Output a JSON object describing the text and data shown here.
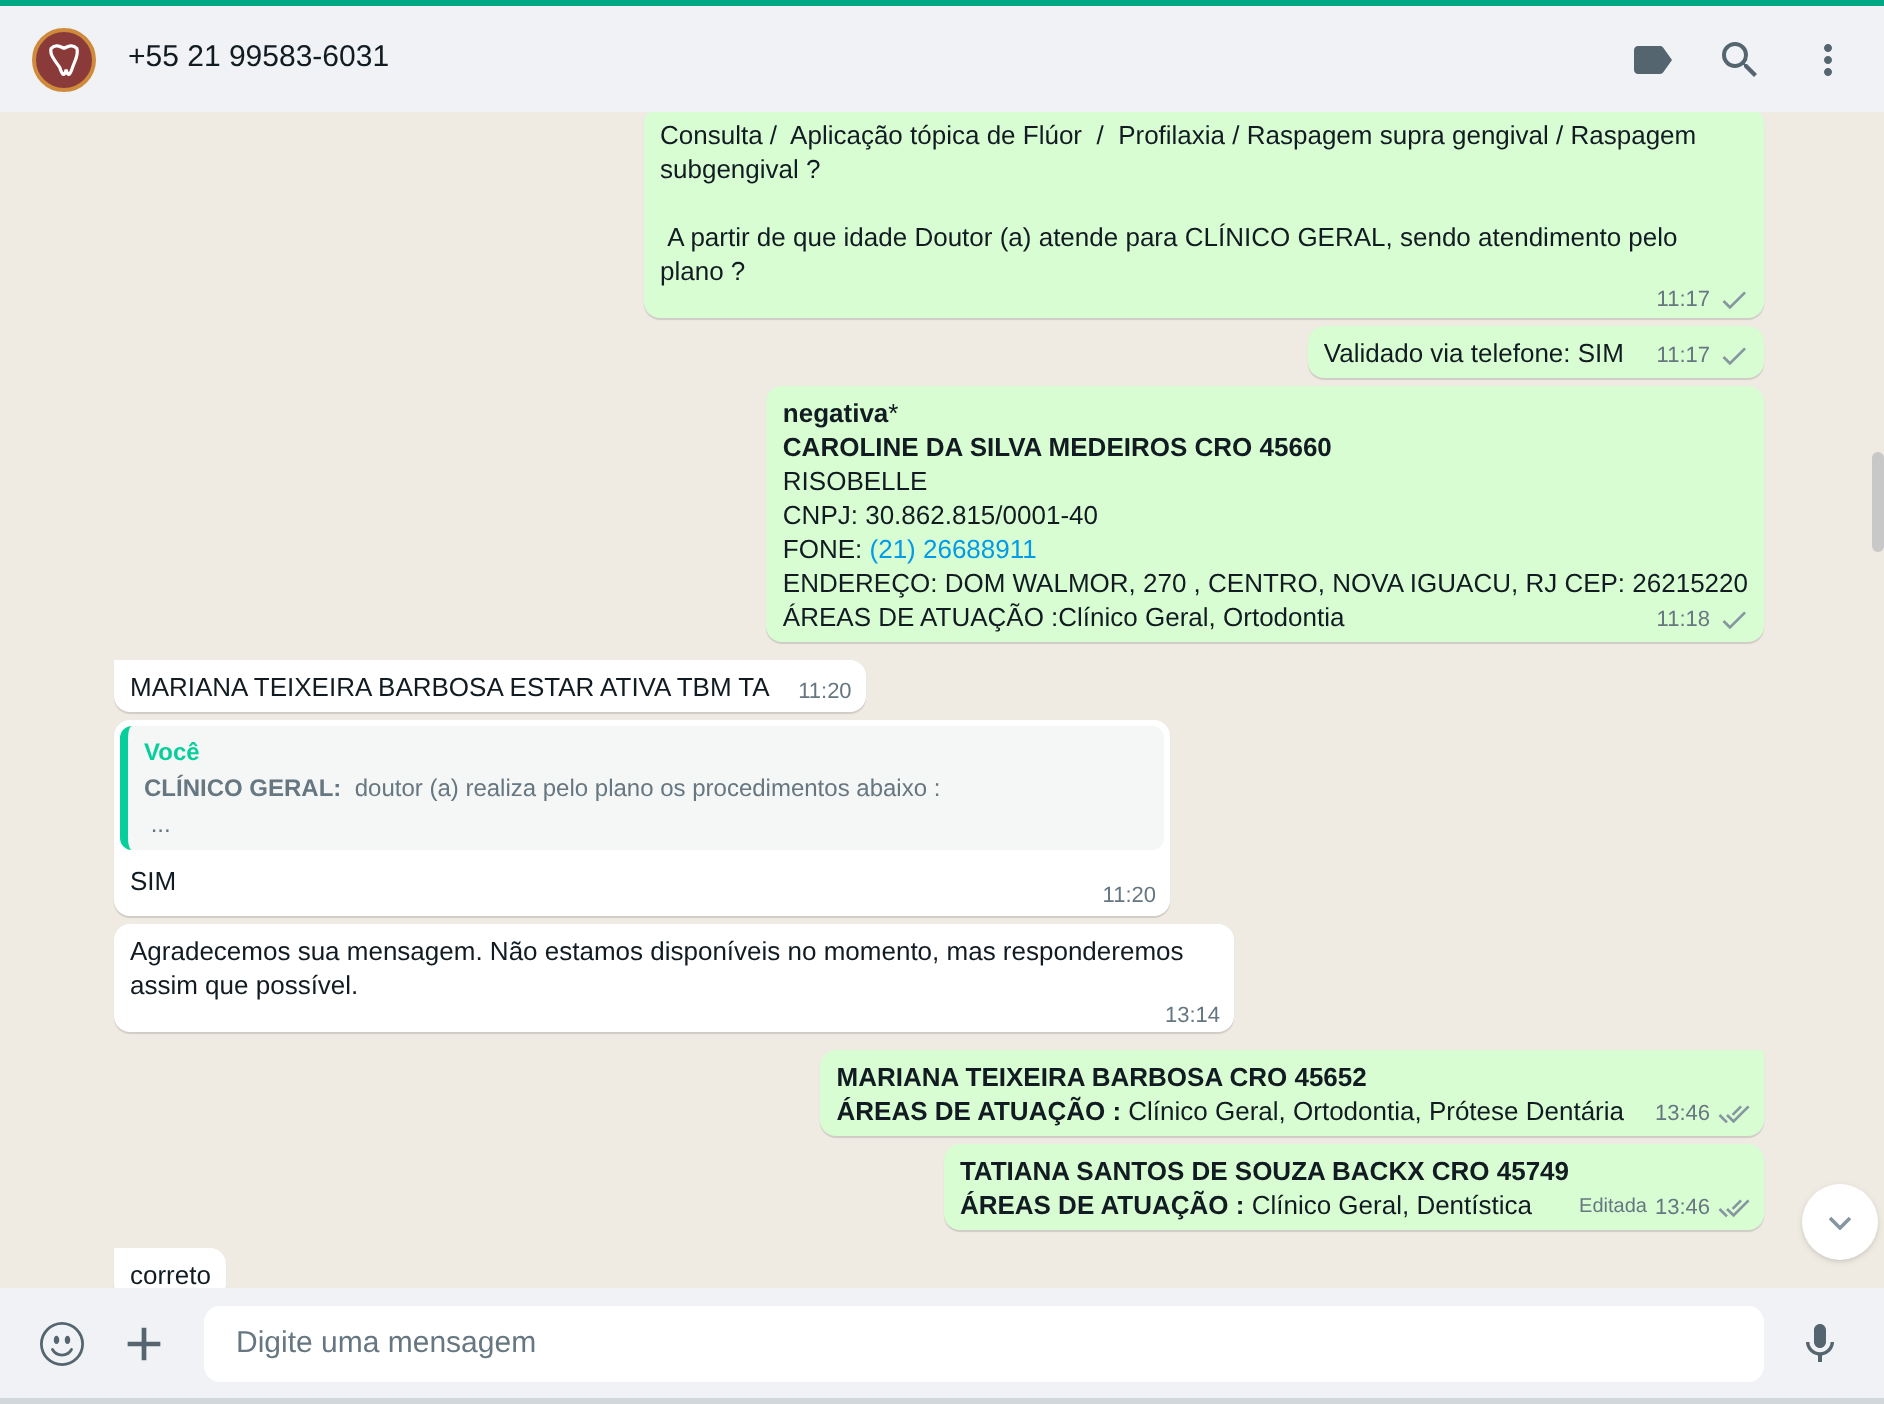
{
  "header": {
    "contact": "+55 21 99583-6031"
  },
  "messages": [
    {
      "kind": "out",
      "paragraphs": [
        "Consulta /  Aplicação tópica de Flúor  /  Profilaxia / Raspagem supra gengival / Raspagem subgengival ?",
        " A partir de que idade Doutor (a) atende para CLÍNICO GERAL, sendo atendimento pelo plano ?"
      ],
      "time": "11:17",
      "read": false,
      "tail": false
    },
    {
      "kind": "out",
      "lines": [
        "Validado via telefone: SIM"
      ],
      "time": "11:17",
      "read": false,
      "tail": false
    },
    {
      "kind": "out",
      "lines": [
        "**negativa***",
        "**CAROLINE DA SILVA MEDEIROS CRO 45660**",
        "RISOBELLE",
        "CNPJ: 30.862.815/0001-40",
        {
          "label": "FONE: ",
          "link": "(21) 26688911"
        },
        "ENDEREÇO: DOM WALMOR, 270 , CENTRO, NOVA IGUACU, RJ CEP: 26215220",
        "ÁREAS DE ATUAÇÃO :Clínico Geral, Ortodontia"
      ],
      "time": "11:18",
      "read": false,
      "tail": false
    },
    {
      "kind": "in",
      "lines": [
        "MARIANA TEIXEIRA BARBOSA ESTAR ATIVA TBM TA"
      ],
      "time": "11:20",
      "tail": true
    },
    {
      "kind": "in",
      "quote": {
        "author": "Você",
        "text": "**CLÍNICO GERAL:**  doutor (a) realiza pelo plano os procedimentos abaixo :",
        "more": " ..."
      },
      "lines": [
        "SIM"
      ],
      "time": "11:20",
      "tail": false
    },
    {
      "kind": "in",
      "paragraphs": [
        "Agradecemos sua mensagem. Não estamos disponíveis no momento, mas responderemos assim que possível."
      ],
      "time": "13:14",
      "tail": false
    },
    {
      "kind": "out",
      "lines": [
        "**MARIANA TEIXEIRA BARBOSA CRO 45652**",
        "**ÁREAS DE ATUAÇÃO :** Clínico Geral, Ortodontia, Prótese Dentária"
      ],
      "time": "13:46",
      "read": true,
      "tail": true
    },
    {
      "kind": "out",
      "lines": [
        "**TATIANA SANTOS DE SOUZA BACKX CRO 45749**",
        "**ÁREAS DE ATUAÇÃO :** Clínico Geral, Dentística"
      ],
      "time": "13:46",
      "read": true,
      "edited": "Editada",
      "tail": false
    },
    {
      "kind": "in",
      "lines": [
        "correto"
      ],
      "tail": true
    }
  ],
  "composer": {
    "placeholder": "Digite uma mensagem"
  }
}
